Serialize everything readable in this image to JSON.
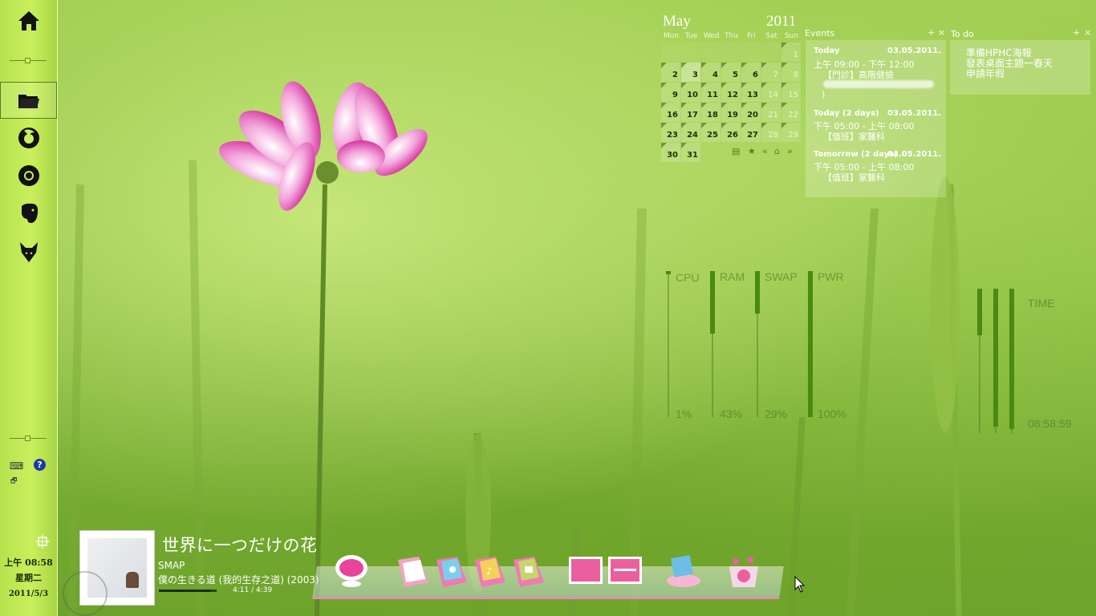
{
  "sidebar": {
    "icons": [
      "home-icon",
      "folder-icon",
      "firefox-icon",
      "chrome-icon",
      "evernote-icon",
      "fox-icon"
    ],
    "tray_icons": [
      "keyboard-icon",
      "help-icon",
      "window-icon"
    ],
    "clock": {
      "time": "上午 08:58",
      "weekday": "星期二",
      "date": "2011/5/3"
    }
  },
  "calendar": {
    "month": "May",
    "year": "2011",
    "weekdays": [
      "Mon",
      "Tue",
      "Wed",
      "Thu",
      "Fri",
      "Sat",
      "Sun"
    ],
    "days": [
      "1",
      "2",
      "3",
      "4",
      "5",
      "6",
      "7",
      "8",
      "9",
      "10",
      "11",
      "12",
      "13",
      "14",
      "15",
      "16",
      "17",
      "18",
      "19",
      "20",
      "21",
      "22",
      "23",
      "24",
      "25",
      "26",
      "27",
      "28",
      "29",
      "30",
      "31"
    ],
    "today": "3"
  },
  "events": {
    "title": "Events",
    "items": [
      {
        "head": "Today",
        "date": "03.05.2011.",
        "time": "上午 09:00 - 下午 12:00",
        "desc": "【門診】高階健檢",
        "extra": ")"
      },
      {
        "head": "Today (2 days)",
        "date": "03.05.2011.",
        "time": "下午 05:00 - 上午 08:00",
        "desc": "【值班】家醫科"
      },
      {
        "head": "Tomorrow (2 days)",
        "date": "04.05.2011.",
        "time": "下午 05:00 - 上午 08:00",
        "desc": "【值班】家醫科"
      }
    ]
  },
  "todo": {
    "title": "To do",
    "items": [
      "準備HPHC海報",
      "發表桌面主題一春天",
      "申請年假"
    ]
  },
  "meters": {
    "cpu": {
      "label": "CPU",
      "value": "1%",
      "fraction": 0.01
    },
    "ram": {
      "label": "RAM",
      "value": "43%",
      "fraction": 0.43
    },
    "swap": {
      "label": "SWAP",
      "value": "29%",
      "fraction": 0.29
    },
    "pwr": {
      "label": "PWR",
      "value": "100%",
      "fraction": 1.0
    },
    "time": {
      "label": "TIME",
      "value": "08:58:59"
    }
  },
  "music": {
    "title": "世界に一つだけの花",
    "artist": "SMAP",
    "album": "僕の生きる道 (我的生存之道) (2003)",
    "time": "4:11 / 4:39",
    "progress": 0.9
  },
  "dock": {
    "items": [
      "pink-orb-icon",
      "pink-folder-icon",
      "blue-flower-folder-icon",
      "music-folder-icon",
      "video-folder-icon",
      "pink-monitor-icon",
      "pink-monitor-2-icon",
      "pink-drive-icon",
      "pink-basket-icon"
    ]
  }
}
